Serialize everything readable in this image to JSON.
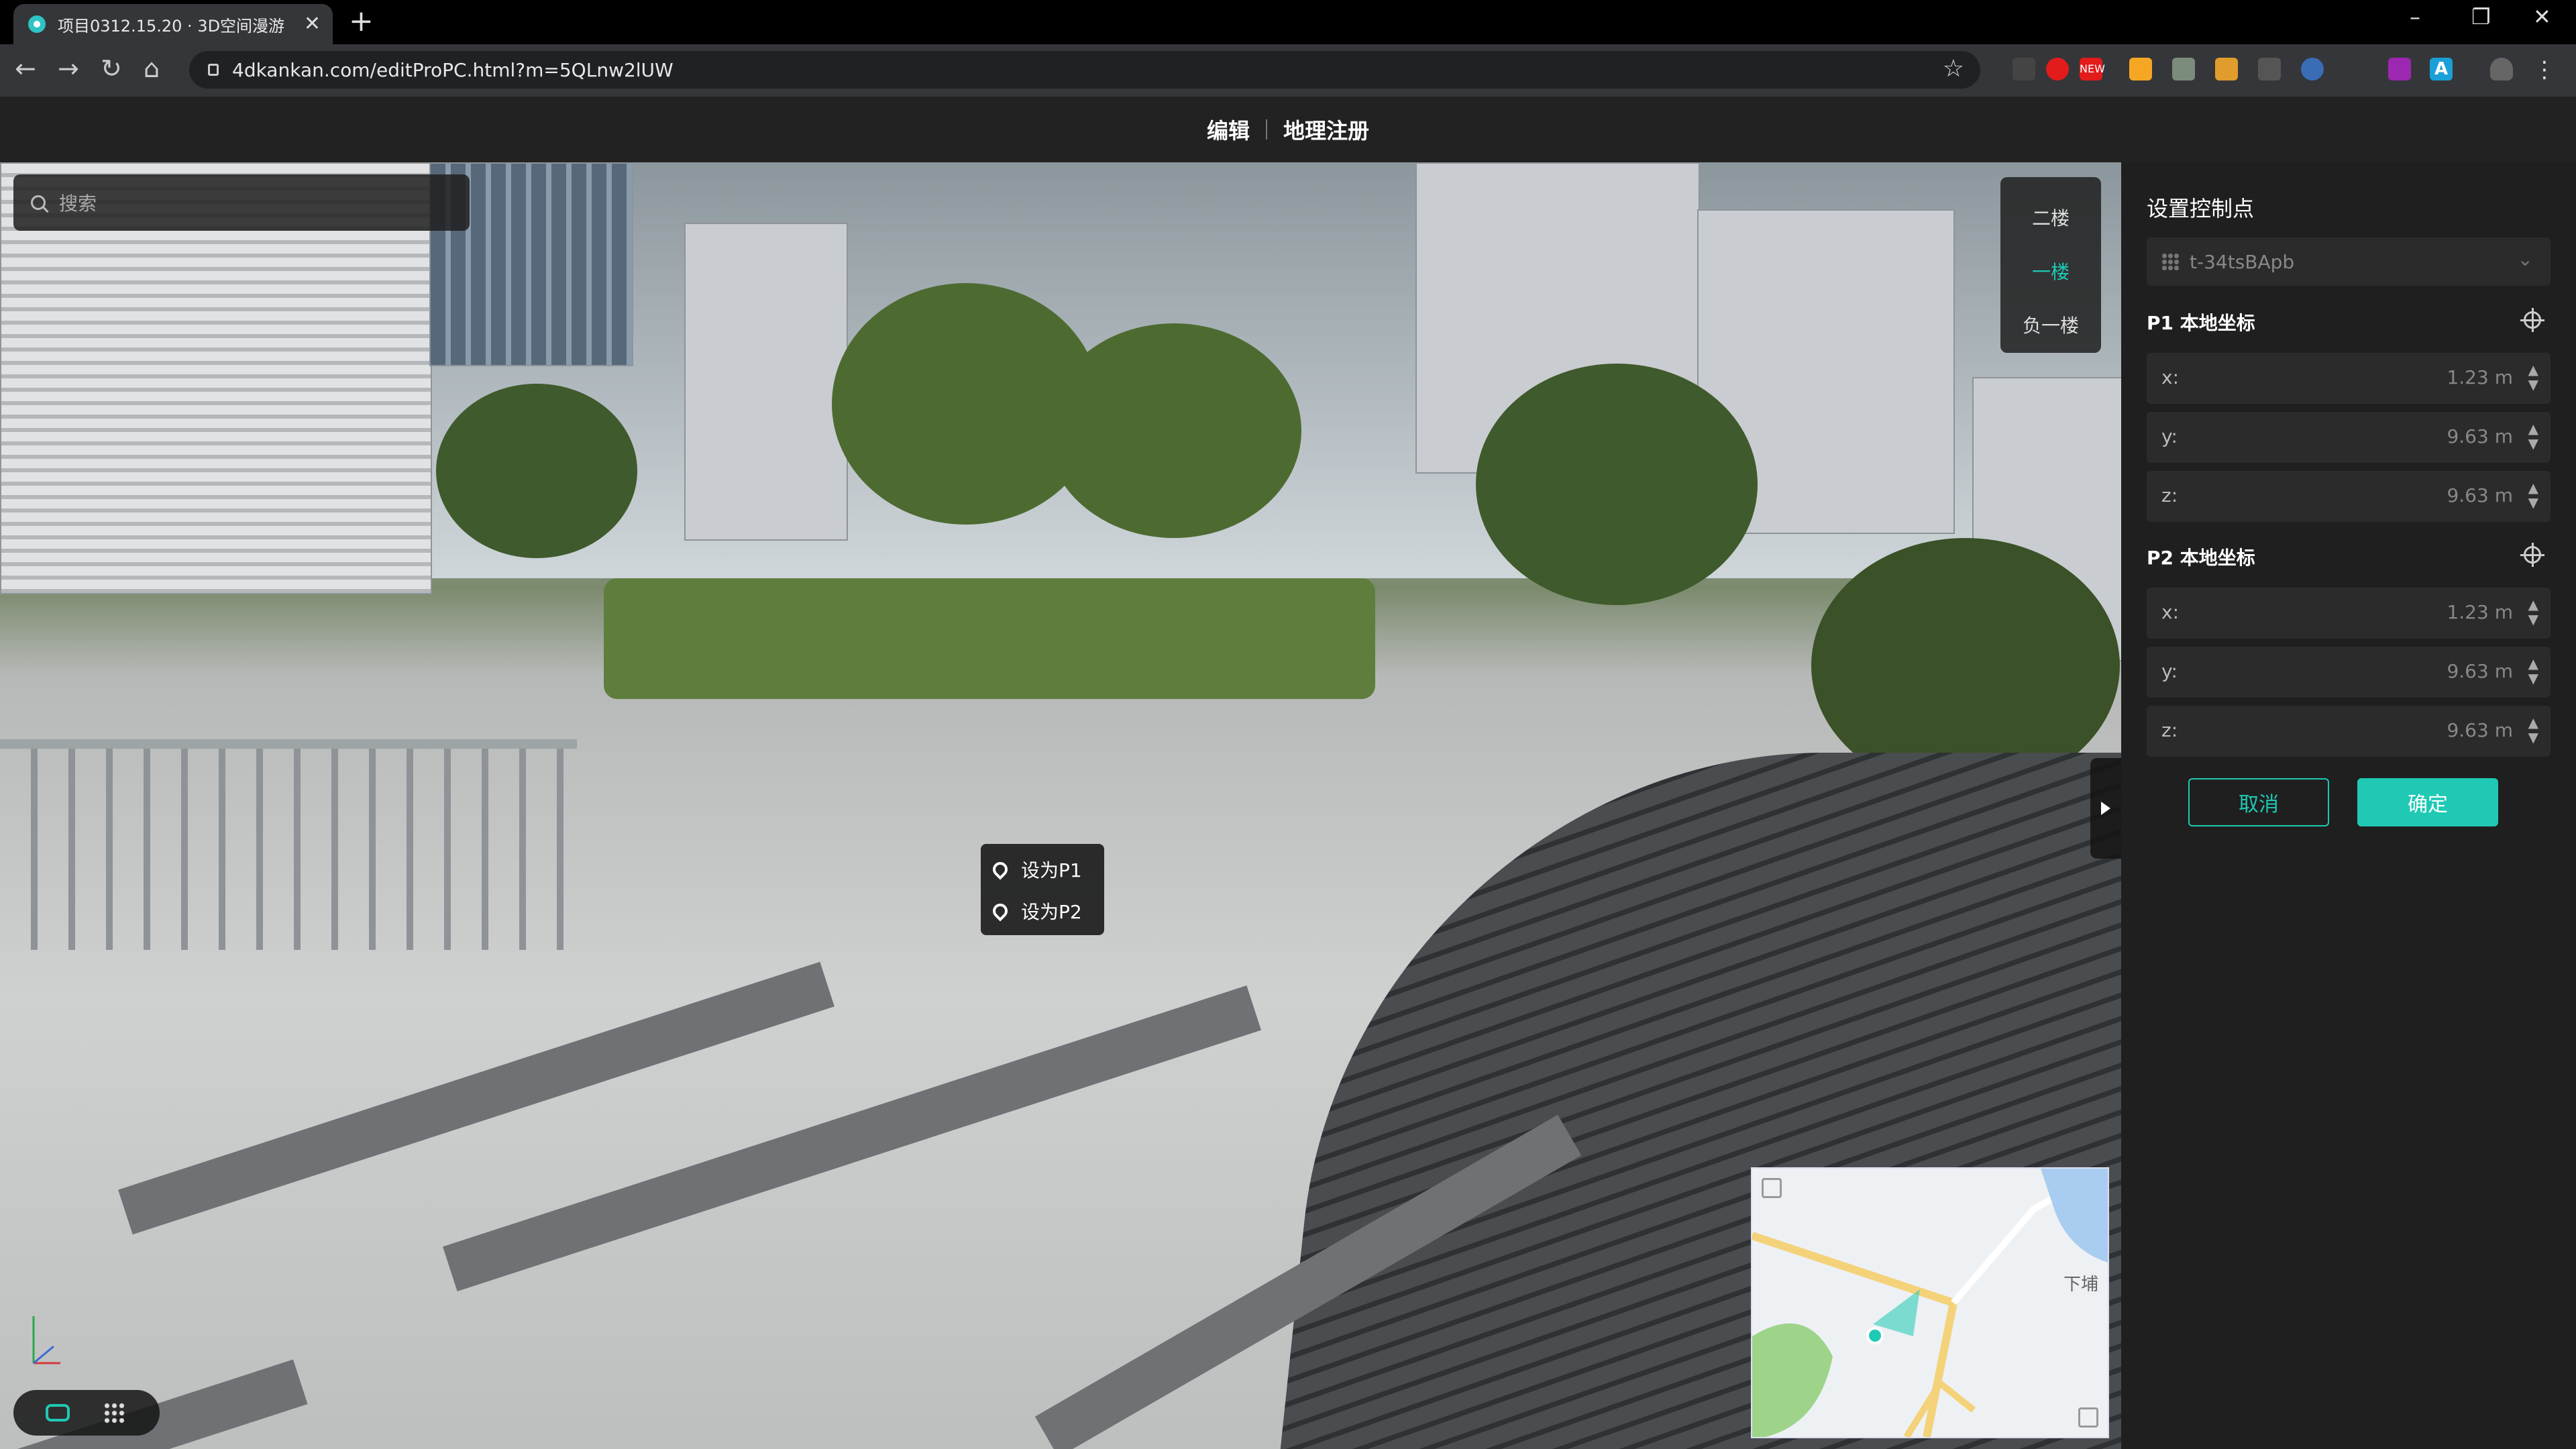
{
  "browser": {
    "tab_title": "项目0312.15.20 · 3D空间漫游",
    "url": "4dkankan.com/editProPC.html?m=5QLnw2lUW",
    "new_badge": "NEW",
    "ext_letter": "A"
  },
  "header": {
    "items": [
      "编辑",
      "地理注册"
    ]
  },
  "viewer": {
    "search_placeholder": "搜索",
    "floors": [
      "二楼",
      "一楼",
      "负一楼"
    ],
    "active_floor": "一楼",
    "context_menu": [
      "设为P1",
      "设为P2"
    ],
    "minimap_label": "下埔"
  },
  "panel": {
    "title": "设置控制点",
    "scene_select": "t-34tsBApb",
    "p1": {
      "label": "P1 本地坐标",
      "fields": [
        {
          "axis": "x:",
          "value": "1.23 m"
        },
        {
          "axis": "y:",
          "value": "9.63 m"
        },
        {
          "axis": "z:",
          "value": "9.63 m"
        }
      ]
    },
    "p2": {
      "label": "P2 本地坐标",
      "fields": [
        {
          "axis": "x:",
          "value": "1.23 m"
        },
        {
          "axis": "y:",
          "value": "9.63 m"
        },
        {
          "axis": "z:",
          "value": "9.63 m"
        }
      ]
    },
    "cancel": "取消",
    "confirm": "确定"
  },
  "colors": {
    "accent": "#1fc9b4",
    "panel_bg": "#1f1f1f"
  }
}
